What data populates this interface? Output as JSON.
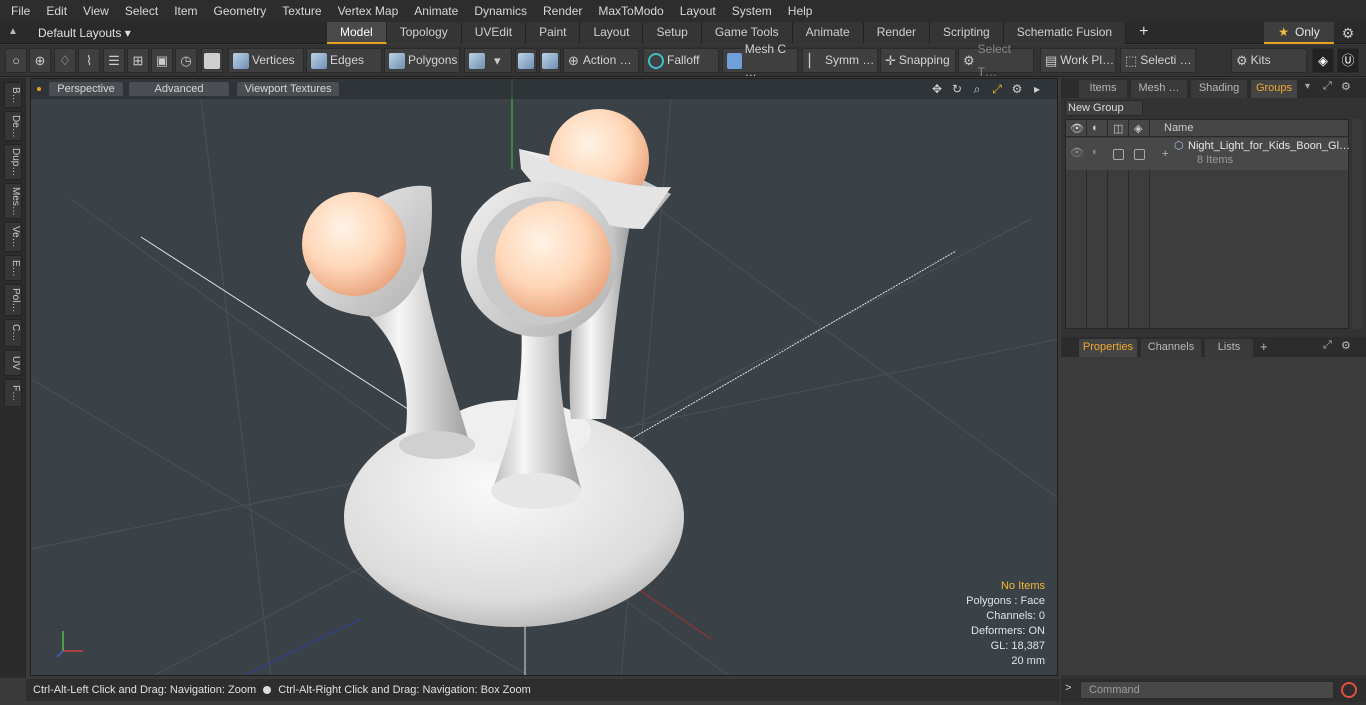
{
  "menu": [
    "File",
    "Edit",
    "View",
    "Select",
    "Item",
    "Geometry",
    "Texture",
    "Vertex Map",
    "Animate",
    "Dynamics",
    "Render",
    "MaxToModo",
    "Layout",
    "System",
    "Help"
  ],
  "layouts": {
    "dropdown": "Default Layouts ▾",
    "tabs": [
      "Model",
      "Topology",
      "UVEdit",
      "Paint",
      "Layout",
      "Setup",
      "Game Tools",
      "Animate",
      "Render",
      "Scripting",
      "Schematic Fusion"
    ],
    "only": "Only"
  },
  "toolbar": {
    "vertices": "Vertices",
    "edges": "Edges",
    "polygons": "Polygons",
    "action": "Action …",
    "falloff": "Falloff",
    "mesh": "Mesh C …",
    "symm": "Symm …",
    "snapping": "Snapping",
    "select_t": "Select T…",
    "workpl": "Work Pl…",
    "selecti": "Selecti …",
    "kits": "Kits"
  },
  "sidetabs": [
    "B…",
    "De…",
    "Dup…",
    "Mes…",
    "Ve…",
    "E…",
    "Pol…",
    "C…",
    "UV",
    "F…"
  ],
  "viewport": {
    "perspective": "Perspective",
    "advanced": "Advanced",
    "textures": "Viewport Textures",
    "stats": {
      "items": "No Items",
      "polygons": "Polygons : Face",
      "channels": "Channels: 0",
      "deformers": "Deformers: ON",
      "gl": "GL: 18,387",
      "scale": "20 mm"
    }
  },
  "status": {
    "left": "Ctrl-Alt-Left Click and Drag: Navigation: Zoom",
    "right": "Ctrl-Alt-Right Click and Drag: Navigation: Box Zoom"
  },
  "panel": {
    "tabs": [
      "Items",
      "Mesh …",
      "Shading",
      "Groups"
    ],
    "new_group": "New Group",
    "col_name": "Name",
    "group_name": "Night_Light_for_Kids_Boon_Gl…",
    "group_count": "8 Items",
    "tabs2": [
      "Properties",
      "Channels",
      "Lists"
    ],
    "command_placeholder": "Command"
  }
}
